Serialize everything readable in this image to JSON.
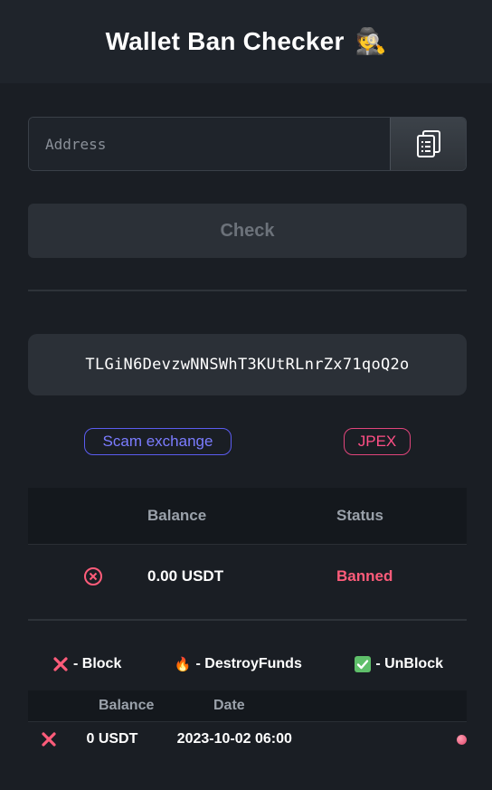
{
  "header": {
    "title": "Wallet Ban Checker",
    "icon": "detective-icon",
    "emoji": "🕵️"
  },
  "search": {
    "placeholder": "Address",
    "paste_icon": "clipboard-icon"
  },
  "check_button": {
    "label": "Check"
  },
  "result": {
    "address": "TLGiN6DevzwNNSWhT3KUtRLnrZx71qoQ2o",
    "tags": [
      {
        "label": "Scam exchange",
        "color": "#7b7cff"
      },
      {
        "label": "JPEX",
        "color": "#ff4f86"
      }
    ]
  },
  "status_table": {
    "headers": {
      "balance": "Balance",
      "status": "Status"
    },
    "row": {
      "icon": "x-circle-icon",
      "balance": "0.00 USDT",
      "status": "Banned",
      "status_color": "#ff5c7a"
    }
  },
  "legend": [
    {
      "icon": "red-x-icon",
      "symbol": "❌",
      "label": "- Block"
    },
    {
      "icon": "fire-icon",
      "symbol": "🔥",
      "label": "- DestroyFunds"
    },
    {
      "icon": "green-check-icon",
      "symbol": "✅",
      "label": "- UnBlock"
    }
  ],
  "history": {
    "headers": {
      "balance": "Balance",
      "date": "Date"
    },
    "rows": [
      {
        "icon": "red-x-icon",
        "balance": "0 USDT",
        "date": "2023-10-02 06:00",
        "indicator": "pink-dot"
      }
    ]
  }
}
